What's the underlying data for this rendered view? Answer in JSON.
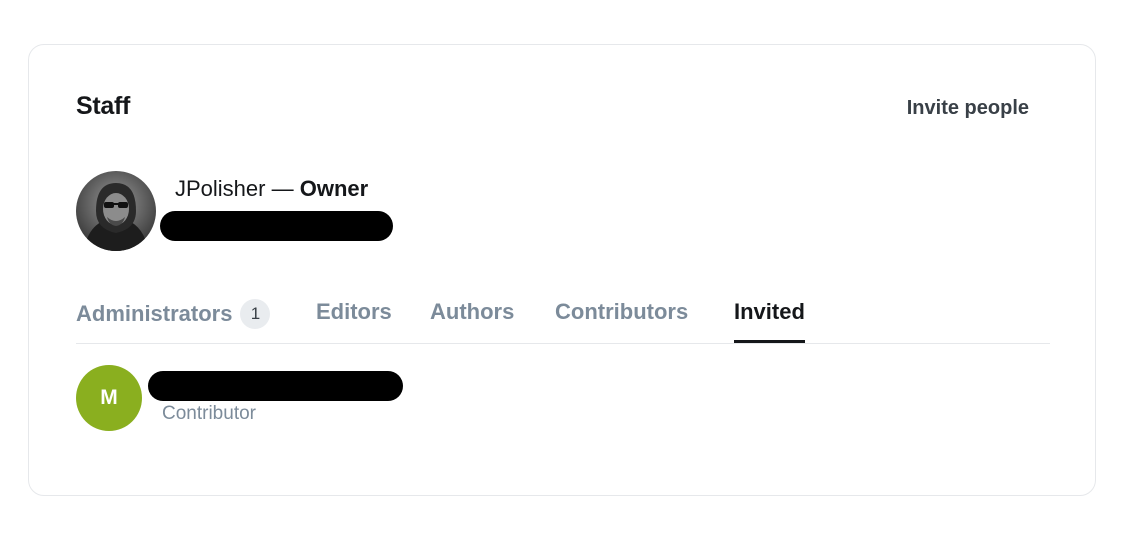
{
  "staff": {
    "title": "Staff",
    "invite_label": "Invite people"
  },
  "owner": {
    "name": "JPolisher",
    "separator": " — ",
    "role": "Owner"
  },
  "tabs": [
    {
      "label": "Administrators",
      "count": "1",
      "active": false
    },
    {
      "label": "Editors",
      "active": false
    },
    {
      "label": "Authors",
      "active": false
    },
    {
      "label": "Contributors",
      "active": false
    },
    {
      "label": "Invited",
      "active": true
    }
  ],
  "invited": [
    {
      "initial": "M",
      "role": "Contributor",
      "avatar_color": "#8aaf1f"
    }
  ],
  "colors": {
    "accent_text": "#15171a",
    "muted_text": "#7c8b9a",
    "avatar_green": "#8aaf1f"
  }
}
